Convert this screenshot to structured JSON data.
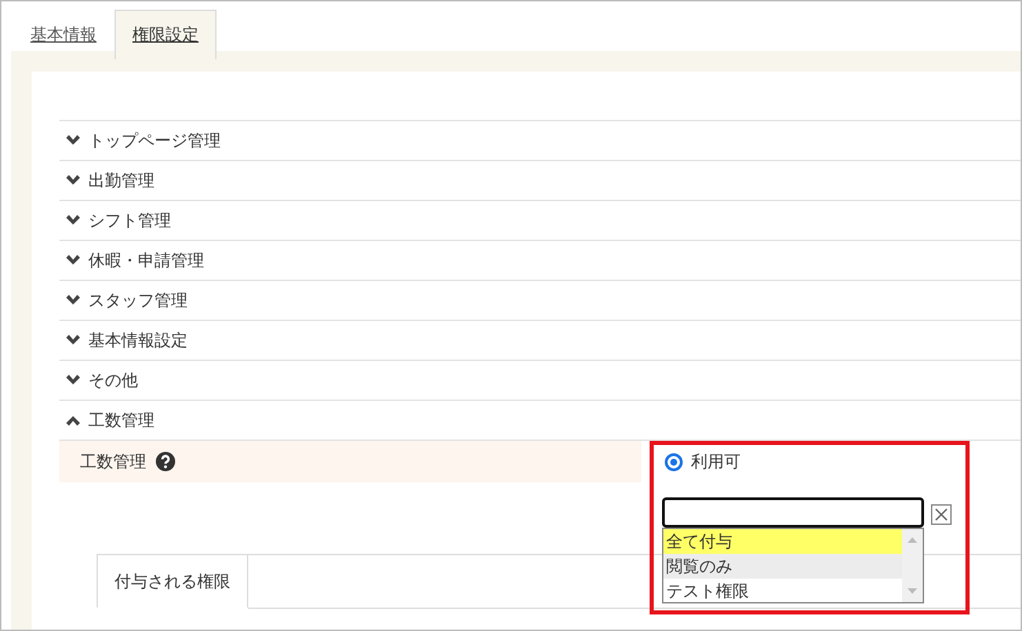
{
  "tabs": [
    {
      "label": "基本情報",
      "selected": false
    },
    {
      "label": "権限設定",
      "selected": true
    }
  ],
  "sections": [
    {
      "label": "トップページ管理",
      "expanded": false
    },
    {
      "label": "出勤管理",
      "expanded": false
    },
    {
      "label": "シフト管理",
      "expanded": false
    },
    {
      "label": "休暇・申請管理",
      "expanded": false
    },
    {
      "label": "スタッフ管理",
      "expanded": false
    },
    {
      "label": "基本情報設定",
      "expanded": false
    },
    {
      "label": "その他",
      "expanded": false
    },
    {
      "label": "工数管理",
      "expanded": true
    }
  ],
  "permission_row": {
    "label": "工数管理",
    "radio": {
      "label": "利用可",
      "selected": true
    },
    "select": {
      "options": [
        {
          "label": "全て付与",
          "selected": true,
          "highlighted": false
        },
        {
          "label": "閲覧のみ",
          "selected": false,
          "highlighted": true
        },
        {
          "label": "テスト権限",
          "selected": false,
          "highlighted": false
        }
      ]
    }
  },
  "sub_tabs": [
    {
      "label": "付与される権限",
      "selected": true
    }
  ]
}
